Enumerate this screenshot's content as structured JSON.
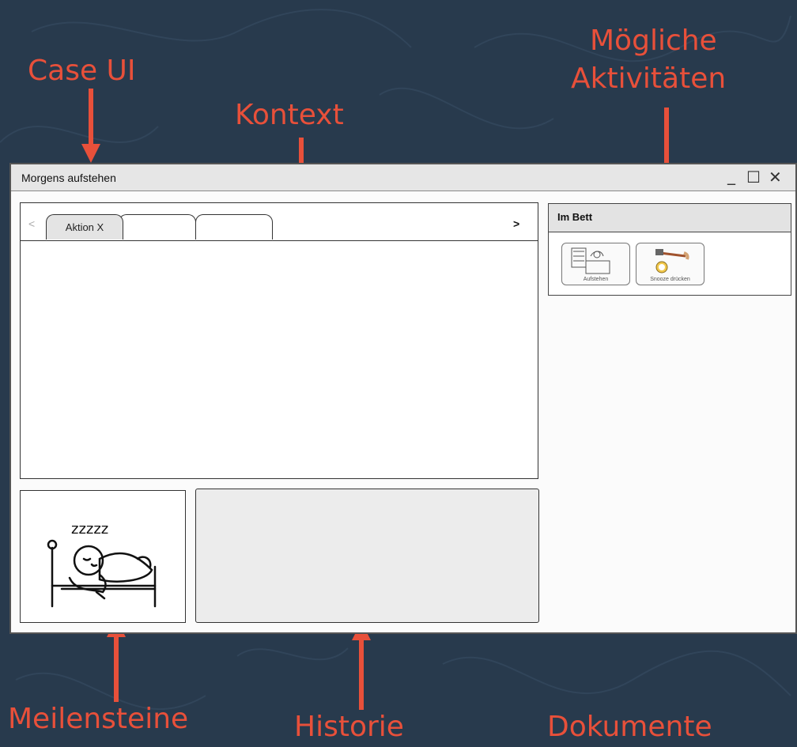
{
  "labels": {
    "case_ui": "Case UI",
    "kontext": "Kontext",
    "activities_line1": "Mögliche",
    "activities_line2": "Aktivitäten",
    "milestones": "Meilensteine",
    "history": "Historie",
    "documents": "Dokumente"
  },
  "window": {
    "title": "Morgens aufstehen",
    "controls": {
      "minimize": "_",
      "maximize": "☐",
      "close": "✕"
    }
  },
  "tabs": {
    "prev": "<",
    "next": ">",
    "items": [
      "Aktion X",
      "",
      ""
    ]
  },
  "activities_panel": {
    "header": "Im Bett",
    "buttons": [
      {
        "label": "Aufstehen",
        "icon": "bedroom-icon"
      },
      {
        "label": "Snooze drücken",
        "icon": "alarm-clock-hammer-icon"
      }
    ]
  },
  "milestone_image": {
    "icon": "sleeping-person-icon",
    "text": "zzzzz"
  },
  "colors": {
    "background": "#283a4d",
    "annotation": "#e8503a"
  }
}
